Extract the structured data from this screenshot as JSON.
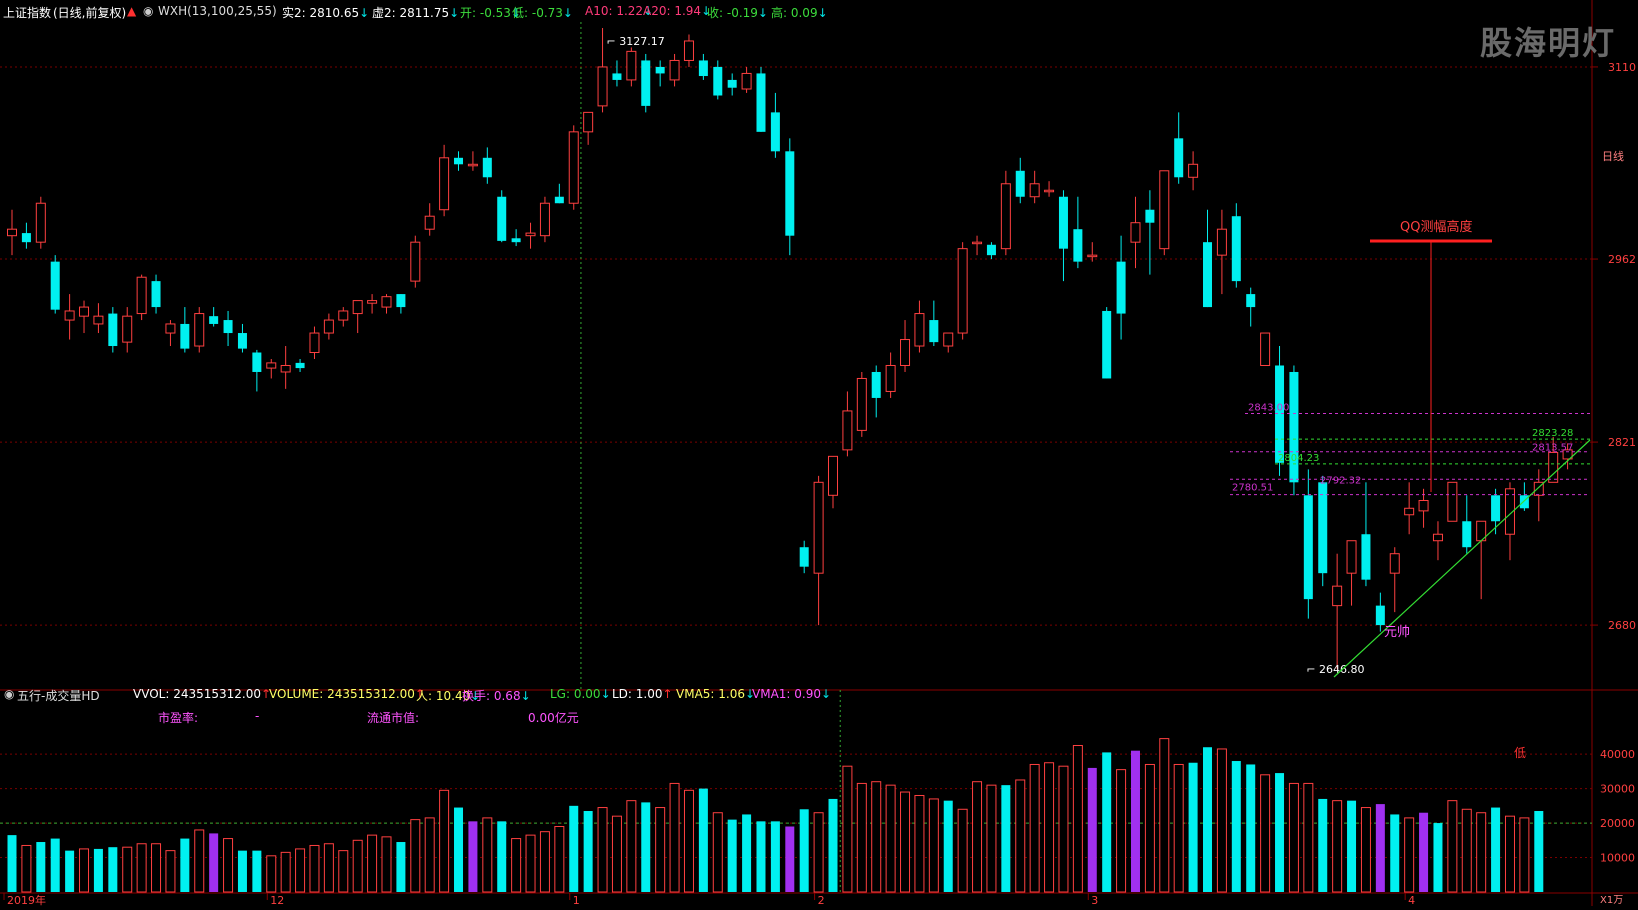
{
  "header": {
    "index_name": "上证指数",
    "mode": "(日线,前复权)",
    "indicator": "WXH(13,100,25,55)",
    "items": [
      {
        "label": "实2:",
        "value": "2810.65",
        "arrow": "↓",
        "color": "#ffffff"
      },
      {
        "label": "虚2:",
        "value": "2811.75",
        "arrow": "↓",
        "color": "#ffffff"
      },
      {
        "label": "开:",
        "value": "-0.53",
        "arrow": "↓",
        "color": "#3cdc3c"
      },
      {
        "label": "低:",
        "value": "-0.73",
        "arrow": "↓",
        "color": "#3cdc3c"
      },
      {
        "label": "A10:",
        "value": "1.22",
        "arrow": "↓",
        "color": "#ff3b7a"
      },
      {
        "label": "A20:",
        "value": "1.94",
        "arrow": "↓",
        "color": "#ff3b7a"
      },
      {
        "label": "收:",
        "value": "-0.19",
        "arrow": "↓",
        "color": "#3cdc3c"
      },
      {
        "label": "高:",
        "value": "0.09",
        "arrow": "↓",
        "color": "#3cdc3c"
      }
    ]
  },
  "watermark": "股海明灯",
  "volume_header": {
    "panel_name": "五行-成交量HD",
    "items": [
      {
        "label": "VVOL:",
        "value": "243515312.00",
        "arrow": "↑",
        "color": "#ffffff"
      },
      {
        "label": "VOLUME:",
        "value": "243515312.00",
        "arrow": "↑",
        "color": "#ffff66"
      },
      {
        "label": "人:",
        "value": "10.40",
        "arrow": "↓",
        "color": "#ffff66"
      },
      {
        "label": "换手:",
        "value": "0.68",
        "arrow": "↓",
        "color": "#ff55ff"
      },
      {
        "label": "LG:",
        "value": "0.00",
        "arrow": "↓",
        "color": "#3cdc3c"
      },
      {
        "label": "LD:",
        "value": "1.00",
        "arrow": "↑",
        "color": "#ffffff"
      },
      {
        "label": "VMA5:",
        "value": "1.06",
        "arrow": "↓",
        "color": "#ffff66"
      },
      {
        "label": "VMA1:",
        "value": "0.90",
        "arrow": "↓",
        "color": "#ff55ff"
      }
    ],
    "pe_label": "市盈率:",
    "pe_value": "-",
    "float_label": "流通市值:",
    "float_value": "0.00亿元"
  },
  "colors": {
    "up": "#ff4040",
    "down": "#00f0f0",
    "purple": "#a030f0",
    "grid": "#7a0000",
    "axis_text": "#ff4040",
    "dashed_pink": "#cc33cc",
    "dashed_green": "#33dd33",
    "trend": "#33dd33",
    "qq_bar": "#ff2020"
  },
  "chart_data": {
    "type": "candlestick",
    "price_ylim": [
      2630,
      3140
    ],
    "price_ticks": [
      2680,
      2821,
      2962,
      3110
    ],
    "volume_ticks": [
      10000,
      20000,
      30000,
      40000
    ],
    "volume_unit": "X1万",
    "period_label": "日线",
    "x_labels": [
      {
        "label": "2019年",
        "bar": 0
      },
      {
        "label": "12",
        "bar": 18
      },
      {
        "label": "1",
        "bar": 39
      },
      {
        "label": "2",
        "bar": 56
      },
      {
        "label": "3",
        "bar": 75
      },
      {
        "label": "4",
        "bar": 97
      }
    ],
    "annotations": {
      "high_label": "3127.17",
      "low_label": "2646.80",
      "yuan_shuai": "元帅",
      "qq_label": "QQ测幅高度",
      "di_label": "低",
      "levels": [
        {
          "value": 2843.0,
          "label": "2843.00",
          "color": "pink"
        },
        {
          "value": 2823.28,
          "label": "2823.28",
          "color": "green"
        },
        {
          "value": 2813.57,
          "label": "2813.57",
          "color": "pink"
        },
        {
          "value": 2804.23,
          "label": "2804.23",
          "color": "green"
        },
        {
          "value": 2792.32,
          "label": "2792.32",
          "color": "pink"
        },
        {
          "value": 2780.51,
          "label": "2780.51",
          "color": "pink"
        }
      ]
    },
    "candles": [
      [
        2980,
        3000,
        2965,
        2985
      ],
      [
        2982,
        2990,
        2970,
        2975
      ],
      [
        2975,
        3010,
        2970,
        3005
      ],
      [
        2960,
        2965,
        2920,
        2923
      ],
      [
        2915,
        2935,
        2900,
        2922
      ],
      [
        2918,
        2930,
        2905,
        2925
      ],
      [
        2912,
        2928,
        2905,
        2918
      ],
      [
        2920,
        2925,
        2890,
        2895
      ],
      [
        2898,
        2925,
        2890,
        2918
      ],
      [
        2920,
        2950,
        2915,
        2948
      ],
      [
        2945,
        2950,
        2920,
        2925
      ],
      [
        2905,
        2915,
        2895,
        2912
      ],
      [
        2912,
        2925,
        2890,
        2893
      ],
      [
        2895,
        2925,
        2890,
        2920
      ],
      [
        2918,
        2925,
        2910,
        2912
      ],
      [
        2915,
        2922,
        2895,
        2905
      ],
      [
        2905,
        2912,
        2890,
        2893
      ],
      [
        2890,
        2892,
        2860,
        2875
      ],
      [
        2878,
        2885,
        2870,
        2882
      ],
      [
        2875,
        2895,
        2862,
        2880
      ],
      [
        2882,
        2885,
        2875,
        2878
      ],
      [
        2890,
        2910,
        2885,
        2905
      ],
      [
        2905,
        2920,
        2900,
        2915
      ],
      [
        2915,
        2925,
        2910,
        2922
      ],
      [
        2920,
        2930,
        2905,
        2930
      ],
      [
        2928,
        2935,
        2920,
        2930
      ],
      [
        2925,
        2935,
        2920,
        2933
      ],
      [
        2935,
        2935,
        2920,
        2925
      ],
      [
        2945,
        2980,
        2940,
        2975
      ],
      [
        2985,
        3005,
        2980,
        2995
      ],
      [
        3000,
        3050,
        2995,
        3040
      ],
      [
        3040,
        3045,
        3030,
        3035
      ],
      [
        3035,
        3045,
        3030,
        3035
      ],
      [
        3040,
        3048,
        3020,
        3025
      ],
      [
        3010,
        3015,
        2975,
        2976
      ],
      [
        2978,
        2985,
        2972,
        2975
      ],
      [
        2980,
        2990,
        2970,
        2982
      ],
      [
        2980,
        3010,
        2975,
        3005
      ],
      [
        3010,
        3020,
        3005,
        3005
      ],
      [
        3005,
        3065,
        3000,
        3060
      ],
      [
        3060,
        3075,
        3050,
        3075
      ],
      [
        3080,
        3140,
        3075,
        3110
      ],
      [
        3105,
        3115,
        3095,
        3100
      ],
      [
        3100,
        3125,
        3095,
        3122
      ],
      [
        3115,
        3120,
        3075,
        3080
      ],
      [
        3110,
        3115,
        3095,
        3105
      ],
      [
        3100,
        3120,
        3095,
        3115
      ],
      [
        3115,
        3135,
        3110,
        3130
      ],
      [
        3115,
        3120,
        3100,
        3103
      ],
      [
        3110,
        3115,
        3085,
        3088
      ],
      [
        3100,
        3105,
        3088,
        3094
      ],
      [
        3093,
        3110,
        3090,
        3105
      ],
      [
        3105,
        3110,
        3060,
        3060
      ],
      [
        3075,
        3090,
        3040,
        3045
      ],
      [
        3045,
        3055,
        2965,
        2980
      ],
      [
        2740,
        2745,
        2720,
        2725
      ],
      [
        2720,
        2795,
        2680,
        2790
      ],
      [
        2780,
        2810,
        2770,
        2810
      ],
      [
        2815,
        2860,
        2810,
        2845
      ],
      [
        2830,
        2875,
        2825,
        2870
      ],
      [
        2875,
        2880,
        2840,
        2855
      ],
      [
        2860,
        2890,
        2855,
        2880
      ],
      [
        2880,
        2915,
        2875,
        2900
      ],
      [
        2895,
        2930,
        2890,
        2920
      ],
      [
        2915,
        2930,
        2895,
        2898
      ],
      [
        2895,
        2905,
        2890,
        2905
      ],
      [
        2905,
        2975,
        2900,
        2970
      ],
      [
        2975,
        2980,
        2965,
        2975
      ],
      [
        2973,
        2975,
        2962,
        2965
      ],
      [
        2970,
        3030,
        2965,
        3020
      ],
      [
        3030,
        3040,
        3005,
        3010
      ],
      [
        3010,
        3030,
        3005,
        3020
      ],
      [
        3015,
        3022,
        3010,
        3015
      ],
      [
        3010,
        3015,
        2945,
        2970
      ],
      [
        2985,
        3010,
        2955,
        2960
      ],
      [
        2965,
        2975,
        2960,
        2965
      ],
      [
        2922,
        2925,
        2870,
        2870
      ],
      [
        2960,
        2980,
        2900,
        2920
      ],
      [
        2975,
        3010,
        2955,
        2990
      ],
      [
        3000,
        3015,
        2950,
        2990
      ],
      [
        2970,
        3000,
        2965,
        3030
      ],
      [
        3055,
        3075,
        3020,
        3025
      ],
      [
        3025,
        3045,
        3015,
        3035
      ],
      [
        2975,
        3000,
        2925,
        2925
      ],
      [
        2965,
        3000,
        2935,
        2985
      ],
      [
        2995,
        3005,
        2940,
        2945
      ],
      [
        2935,
        2940,
        2910,
        2925
      ],
      [
        2880,
        2900,
        2880,
        2905
      ],
      [
        2880,
        2895,
        2795,
        2805
      ],
      [
        2875,
        2880,
        2780,
        2790
      ],
      [
        2780,
        2800,
        2685,
        2700
      ],
      [
        2790,
        2795,
        2710,
        2720
      ],
      [
        2695,
        2735,
        2646,
        2710
      ],
      [
        2720,
        2745,
        2695,
        2745
      ],
      [
        2750,
        2790,
        2710,
        2715
      ],
      [
        2695,
        2705,
        2675,
        2680
      ],
      [
        2720,
        2740,
        2690,
        2735
      ],
      [
        2765,
        2790,
        2750,
        2770
      ],
      [
        2768,
        2785,
        2755,
        2776
      ],
      [
        2745,
        2760,
        2730,
        2750
      ],
      [
        2760,
        2790,
        2760,
        2790
      ],
      [
        2760,
        2780,
        2735,
        2740
      ],
      [
        2745,
        2755,
        2700,
        2760
      ],
      [
        2780,
        2785,
        2750,
        2760
      ],
      [
        2750,
        2790,
        2730,
        2785
      ],
      [
        2780,
        2790,
        2768,
        2770
      ],
      [
        2780,
        2800,
        2760,
        2790
      ],
      [
        2790,
        2825,
        2790,
        2813
      ],
      [
        2808,
        2820,
        2800,
        2815
      ]
    ],
    "volumes": [
      [
        16500,
        "d"
      ],
      [
        13500,
        "u"
      ],
      [
        14500,
        "d"
      ],
      [
        15500,
        "d"
      ],
      [
        12000,
        "d"
      ],
      [
        12500,
        "u"
      ],
      [
        12500,
        "d"
      ],
      [
        13000,
        "d"
      ],
      [
        13000,
        "u"
      ],
      [
        14000,
        "u"
      ],
      [
        14000,
        "u"
      ],
      [
        12000,
        "u"
      ],
      [
        15500,
        "d"
      ],
      [
        18000,
        "u"
      ],
      [
        17000,
        "p"
      ],
      [
        15500,
        "u"
      ],
      [
        12000,
        "d"
      ],
      [
        12000,
        "d"
      ],
      [
        10500,
        "u"
      ],
      [
        11500,
        "u"
      ],
      [
        12500,
        "u"
      ],
      [
        13500,
        "u"
      ],
      [
        14000,
        "u"
      ],
      [
        12000,
        "u"
      ],
      [
        15000,
        "u"
      ],
      [
        16500,
        "u"
      ],
      [
        16000,
        "u"
      ],
      [
        14500,
        "d"
      ],
      [
        21000,
        "u"
      ],
      [
        21500,
        "u"
      ],
      [
        29500,
        "u"
      ],
      [
        24500,
        "d"
      ],
      [
        20500,
        "p"
      ],
      [
        21500,
        "u"
      ],
      [
        20500,
        "d"
      ],
      [
        15500,
        "u"
      ],
      [
        16500,
        "u"
      ],
      [
        17500,
        "u"
      ],
      [
        19000,
        "u"
      ],
      [
        25000,
        "d"
      ],
      [
        23500,
        "d"
      ],
      [
        24500,
        "u"
      ],
      [
        22000,
        "u"
      ],
      [
        26500,
        "u"
      ],
      [
        26000,
        "d"
      ],
      [
        24500,
        "u"
      ],
      [
        31500,
        "u"
      ],
      [
        29500,
        "u"
      ],
      [
        30000,
        "d"
      ],
      [
        23000,
        "u"
      ],
      [
        21000,
        "d"
      ],
      [
        22500,
        "d"
      ],
      [
        20500,
        "d"
      ],
      [
        20500,
        "d"
      ],
      [
        19000,
        "p"
      ],
      [
        24000,
        "d"
      ],
      [
        23000,
        "u"
      ],
      [
        27000,
        "d"
      ],
      [
        36500,
        "u"
      ],
      [
        31500,
        "u"
      ],
      [
        32000,
        "u"
      ],
      [
        31000,
        "u"
      ],
      [
        29000,
        "u"
      ],
      [
        28000,
        "u"
      ],
      [
        27000,
        "u"
      ],
      [
        26500,
        "d"
      ],
      [
        24000,
        "u"
      ],
      [
        32000,
        "u"
      ],
      [
        31000,
        "u"
      ],
      [
        31000,
        "d"
      ],
      [
        32500,
        "u"
      ],
      [
        37000,
        "u"
      ],
      [
        37500,
        "u"
      ],
      [
        36500,
        "u"
      ],
      [
        42500,
        "u"
      ],
      [
        36000,
        "p"
      ],
      [
        40500,
        "d"
      ],
      [
        35500,
        "u"
      ],
      [
        41000,
        "p"
      ],
      [
        37000,
        "u"
      ],
      [
        44500,
        "u"
      ],
      [
        37000,
        "u"
      ],
      [
        37500,
        "d"
      ],
      [
        42000,
        "d"
      ],
      [
        41500,
        "u"
      ],
      [
        38000,
        "d"
      ],
      [
        37000,
        "d"
      ],
      [
        34000,
        "u"
      ],
      [
        34500,
        "d"
      ],
      [
        31500,
        "u"
      ],
      [
        31500,
        "u"
      ],
      [
        27000,
        "d"
      ],
      [
        26500,
        "u"
      ],
      [
        26500,
        "d"
      ],
      [
        24500,
        "u"
      ],
      [
        25500,
        "p"
      ],
      [
        22500,
        "d"
      ],
      [
        21500,
        "u"
      ],
      [
        23000,
        "p"
      ],
      [
        20000,
        "d"
      ],
      [
        26500,
        "u"
      ],
      [
        24000,
        "u"
      ],
      [
        23000,
        "u"
      ],
      [
        24500,
        "d"
      ],
      [
        22000,
        "u"
      ],
      [
        21500,
        "u"
      ],
      [
        23500,
        "d"
      ]
    ]
  }
}
